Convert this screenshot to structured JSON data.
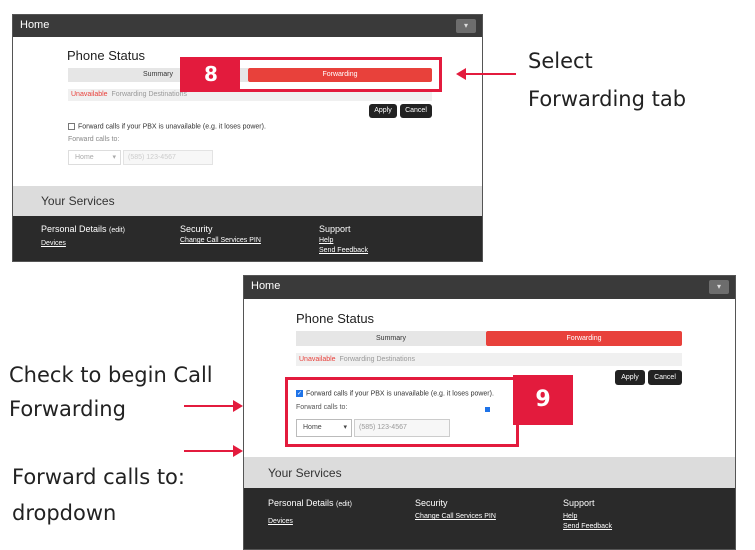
{
  "top": {
    "home": "Home",
    "phone_status": "Phone Status",
    "tab_summary": "Summary",
    "tab_forwarding": "Forwarding",
    "subtab_unavailable": "Unavailable",
    "subtab_destinations": "Forwarding Destinations",
    "apply": "Apply",
    "cancel": "Cancel",
    "checkbox_label": "Forward calls if your PBX is unavailable (e.g. it loses power).",
    "forward_to_label": "Forward calls to:",
    "dropdown_value": "Home",
    "phone_placeholder": "(585) 123-4567",
    "services": "Your Services",
    "personal": "Personal Details",
    "personal_edit": "(edit)",
    "devices": "Devices",
    "security": "Security",
    "change_pin": "Change Call Services PIN",
    "support": "Support",
    "help": "Help",
    "feedback": "Send Feedback",
    "step": "8"
  },
  "bottom": {
    "home": "Home",
    "phone_status": "Phone Status",
    "tab_summary": "Summary",
    "tab_forwarding": "Forwarding",
    "subtab_unavailable": "Unavailable",
    "subtab_destinations": "Forwarding Destinations",
    "apply": "Apply",
    "cancel": "Cancel",
    "checkbox_label": "Forward calls if your PBX is unavailable (e.g. it loses power).",
    "forward_to_label": "Forward calls to:",
    "dropdown_value": "Home",
    "phone_placeholder": "(585) 123-4567",
    "services": "Your Services",
    "personal": "Personal Details",
    "personal_edit": "(edit)",
    "devices": "Devices",
    "security": "Security",
    "change_pin": "Change Call Services PIN",
    "support": "Support",
    "help": "Help",
    "feedback": "Send Feedback",
    "step": "9"
  },
  "callouts": {
    "select_line1": "Select",
    "select_line2": "Forwarding tab",
    "check_line1": "Check to begin Call",
    "check_line2": "Forwarding",
    "forward_line1": "Forward calls to:",
    "forward_line2": "dropdown"
  },
  "colors": {
    "accent": "#e8413b",
    "highlight": "#e31b3d"
  }
}
